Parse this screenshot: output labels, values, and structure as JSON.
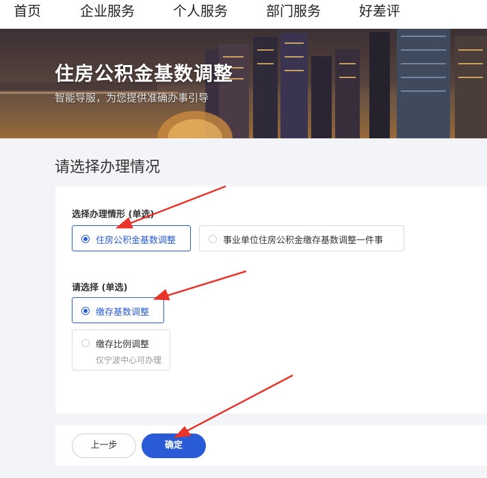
{
  "nav": {
    "items": [
      {
        "label": "首页"
      },
      {
        "label": "企业服务"
      },
      {
        "label": "个人服务"
      },
      {
        "label": "部门服务"
      },
      {
        "label": "好差评"
      }
    ]
  },
  "hero": {
    "title": "住房公积金基数调整",
    "subtitle": "智能导服，为您提供准确办事引导"
  },
  "main": {
    "title": "请选择办理情况",
    "group1": {
      "label": "选择办理情形 (单选)",
      "options": [
        {
          "label": "住房公积金基数调整",
          "selected": true
        },
        {
          "label": "事业单位住房公积金缴存基数调整一件事",
          "selected": false
        }
      ]
    },
    "group2": {
      "label": "请选择 (单选)",
      "options": [
        {
          "label": "缴存基数调整",
          "selected": true
        },
        {
          "label": "缴存比例调整",
          "note": "仅宁波中心可办理",
          "selected": false
        }
      ]
    }
  },
  "footer": {
    "prev_label": "上一步",
    "confirm_label": "确定"
  },
  "colors": {
    "accent": "#2a5bd7",
    "annotation_arrow": "#e8332a"
  }
}
